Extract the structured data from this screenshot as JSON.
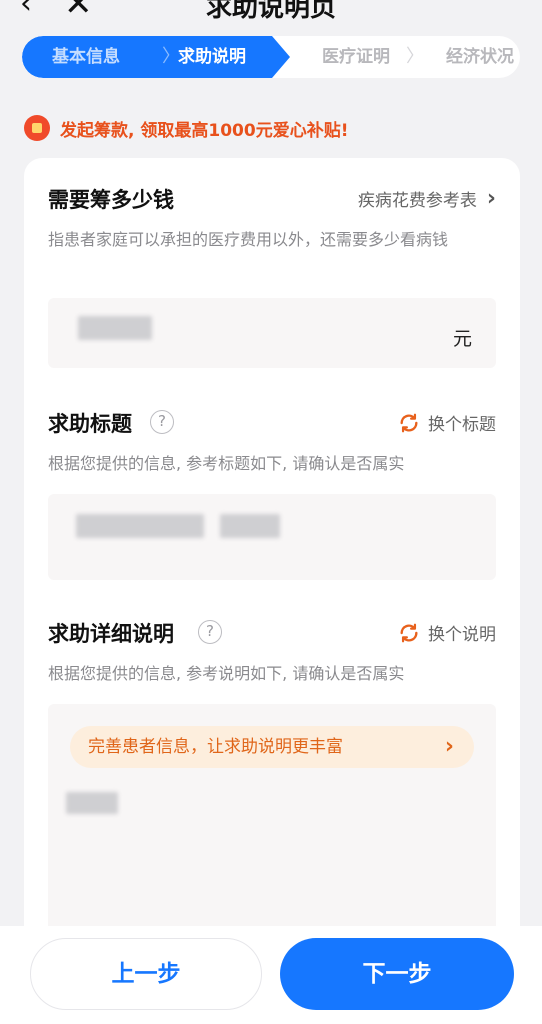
{
  "nav": {
    "back_glyph": "‹",
    "close_glyph": "✕",
    "title": "求助说明页"
  },
  "stepper": {
    "steps": [
      {
        "label": "基本信息",
        "state": "done"
      },
      {
        "label": "求助说明",
        "state": "current"
      },
      {
        "label": "医疗证明",
        "state": "pending"
      },
      {
        "label": "经济状况",
        "state": "pending"
      }
    ],
    "separator": "〉"
  },
  "promo": {
    "icon": "red-envelope-icon",
    "text": "发起筹款, 领取最高1000元爱心补贴!"
  },
  "sections": {
    "amount": {
      "title": "需要筹多少钱",
      "link_label": "疾病花费参考表",
      "description": "指患者家庭可以承担的医疗费用以外，还需要多少看病钱",
      "unit": "元"
    },
    "help_title": {
      "title": "求助标题",
      "help_glyph": "?",
      "action_label": "换个标题",
      "description": "根据您提供的信息, 参考标题如下, 请确认是否属实"
    },
    "detail": {
      "title": "求助详细说明",
      "help_glyph": "?",
      "action_label": "换个说明",
      "description": "根据您提供的信息, 参考说明如下, 请确认是否属实",
      "hint": "完善患者信息，让求助说明更丰富"
    }
  },
  "footer": {
    "prev_label": "上一步",
    "next_label": "下一步"
  },
  "colors": {
    "primary": "#1677ff",
    "promo": "#e8511c",
    "hint_bg": "#fdeedd"
  }
}
